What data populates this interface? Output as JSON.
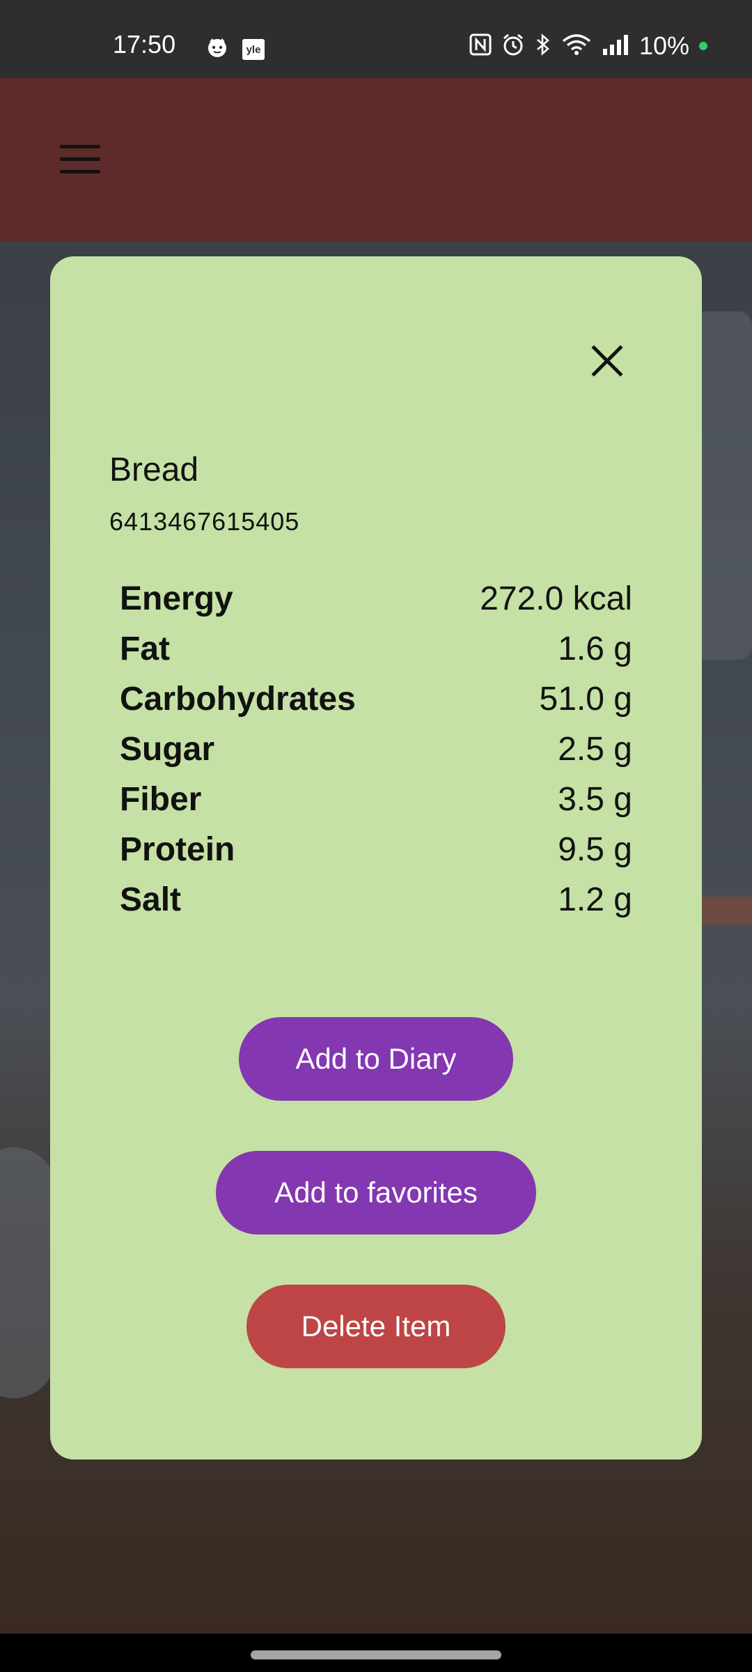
{
  "status_bar": {
    "time": "17:50",
    "left_icons": [
      "cat-face-icon",
      "yle-icon"
    ],
    "yle_text": "yle",
    "right_icons": [
      "nfc-icon",
      "alarm-icon",
      "bluetooth-icon",
      "wifi-icon",
      "signal-icon"
    ],
    "battery": "10%",
    "battery_dot_color": "#2fd06a"
  },
  "app_bar": {
    "color": "#5d2b29",
    "menu_icon": "hamburger-menu-icon"
  },
  "dialog": {
    "background": "#c5e1a5",
    "close_icon": "close-icon",
    "item_name": "Bread",
    "barcode": "6413467615405",
    "nutrients": [
      {
        "label": "Energy",
        "value": "272.0 kcal"
      },
      {
        "label": "Fat",
        "value": "1.6 g"
      },
      {
        "label": "Carbohydrates",
        "value": "51.0 g"
      },
      {
        "label": "Sugar",
        "value": "2.5 g"
      },
      {
        "label": "Fiber",
        "value": "3.5 g"
      },
      {
        "label": "Protein",
        "value": "9.5 g"
      },
      {
        "label": "Salt",
        "value": "1.2 g"
      }
    ],
    "buttons": {
      "add_to_diary": "Add to Diary",
      "add_to_favorites": "Add to favorites",
      "delete_item": "Delete Item"
    },
    "colors": {
      "primary_button": "#8337b0",
      "delete_button": "#bd4545"
    }
  }
}
